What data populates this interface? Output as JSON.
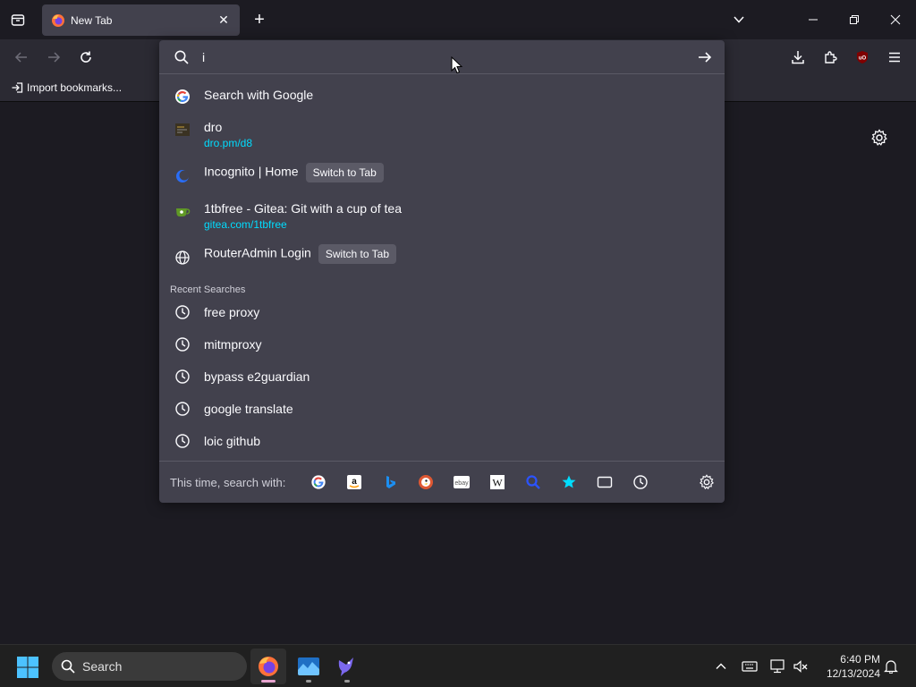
{
  "browser": {
    "tab": {
      "title": "New Tab",
      "close": "✕"
    },
    "new_tab": "+",
    "bookmarks": {
      "import_label": "Import bookmarks..."
    }
  },
  "urlbar": {
    "value": "i",
    "results": [
      {
        "title": "Search with Google",
        "url": "",
        "badge": "",
        "icon": "google-icon"
      },
      {
        "title": "dro",
        "url": "dro.pm/d8",
        "badge": "",
        "icon": "dro-favicon-icon"
      },
      {
        "title": "Incognito | Home",
        "url": "",
        "badge": "Switch to Tab",
        "icon": "incognito-favicon-icon"
      },
      {
        "title": "1tbfree - Gitea: Git with a cup of tea",
        "url": "gitea.com/1tbfree",
        "badge": "",
        "icon": "gitea-favicon-icon"
      },
      {
        "title": "RouterAdmin Login",
        "url": "",
        "badge": "Switch to Tab",
        "icon": "globe-icon"
      }
    ],
    "recent_label": "Recent Searches",
    "recent": [
      "free proxy",
      "mitmproxy",
      "bypass e2guardian",
      "google translate",
      "loic github"
    ],
    "search_with_label": "This time, search with:",
    "engines": [
      "google",
      "amazon",
      "bing",
      "duckduckgo",
      "ebay",
      "wikipedia",
      "search",
      "bookmarks",
      "tabs",
      "history"
    ]
  },
  "taskbar": {
    "search_label": "Search",
    "time": "6:40 PM",
    "date": "12/13/2024"
  },
  "colors": {
    "popup_bg": "#42414d",
    "url_color": "#00ddff",
    "toolbar_bg": "#2b2a33",
    "page_bg": "#1c1b22"
  }
}
